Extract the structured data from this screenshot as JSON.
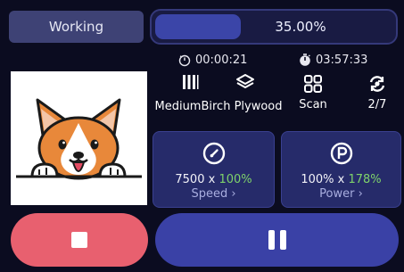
{
  "status": {
    "label": "Working"
  },
  "progress": {
    "percent_text": "35.00%",
    "value": 0.35
  },
  "time": {
    "elapsed": "00:00:21",
    "remaining": "03:57:33"
  },
  "stats": {
    "material": "MediumBirch Plywood",
    "mode": "Scan",
    "pass": "2/7"
  },
  "speed": {
    "base": "7500",
    "times": " x ",
    "pct": "100%",
    "label": "Speed"
  },
  "power": {
    "base": "100%",
    "times": " x ",
    "pct": "178%",
    "label": "Power"
  },
  "colors": {
    "accent": "#3a41a6",
    "stop": "#e8606f",
    "highlight": "#7fd36b",
    "background": "#0b0c20"
  },
  "icons": {
    "elapsed": "stopwatch-icon",
    "remaining": "timer-icon",
    "lines": "scan-lines-icon",
    "material": "material-icon",
    "mode": "grid-icon",
    "pass": "repeat-icon",
    "speed": "gauge-icon",
    "power": "power-p-icon",
    "stop": "stop-icon",
    "pause": "pause-icon"
  }
}
